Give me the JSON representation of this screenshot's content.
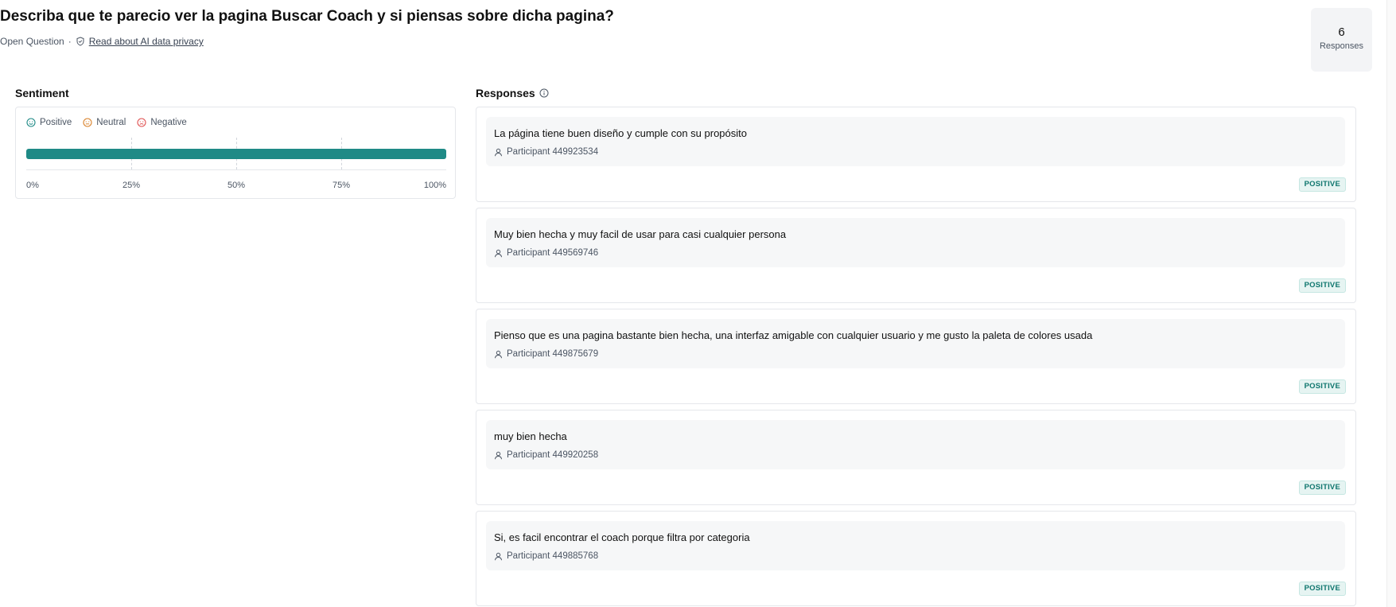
{
  "header": {
    "title": "Describa que te parecio ver la pagina Buscar Coach y si piensas sobre dicha pagina?",
    "question_type": "Open Question",
    "separator": "·",
    "privacy_link": "Read about AI data privacy",
    "response_count": "6",
    "response_count_label": "Responses"
  },
  "sentiment": {
    "title": "Sentiment",
    "legend": [
      {
        "label": "Positive",
        "icon": "smile-icon",
        "color": "#1f8a86"
      },
      {
        "label": "Neutral",
        "icon": "neutral-face-icon",
        "color": "#d9822b"
      },
      {
        "label": "Negative",
        "icon": "frown-icon",
        "color": "#e05252"
      }
    ]
  },
  "chart_data": {
    "type": "bar",
    "orientation": "horizontal-stacked",
    "title": "",
    "xlabel": "",
    "ylabel": "",
    "x_ticks": [
      "0%",
      "25%",
      "50%",
      "75%",
      "100%"
    ],
    "xlim": [
      0,
      100
    ],
    "grid": true,
    "legend_position": "top-left",
    "series": [
      {
        "name": "Positive",
        "values": [
          100
        ],
        "color": "#1f8a86"
      },
      {
        "name": "Neutral",
        "values": [
          0
        ],
        "color": "#d9822b"
      },
      {
        "name": "Negative",
        "values": [
          0
        ],
        "color": "#e05252"
      }
    ]
  },
  "responses_section": {
    "title": "Responses",
    "items": [
      {
        "text": "La página tiene buen diseño y cumple con su propósito",
        "participant": "Participant 449923534",
        "sentiment": "POSITIVE"
      },
      {
        "text": "Muy bien hecha y muy facil de usar para casi cualquier persona",
        "participant": "Participant 449569746",
        "sentiment": "POSITIVE"
      },
      {
        "text": "Pienso que es una pagina bastante bien hecha, una interfaz amigable con cualquier usuario y me gusto la paleta de colores usada",
        "participant": "Participant 449875679",
        "sentiment": "POSITIVE"
      },
      {
        "text": "muy bien hecha",
        "participant": "Participant 449920258",
        "sentiment": "POSITIVE"
      },
      {
        "text": "Si, es facil encontrar el coach porque filtra por categoria",
        "participant": "Participant 449885768",
        "sentiment": "POSITIVE"
      }
    ]
  },
  "colors": {
    "accent": "#1f8a86",
    "badge_text": "#0f766e",
    "badge_bg": "#e6f4f2"
  }
}
